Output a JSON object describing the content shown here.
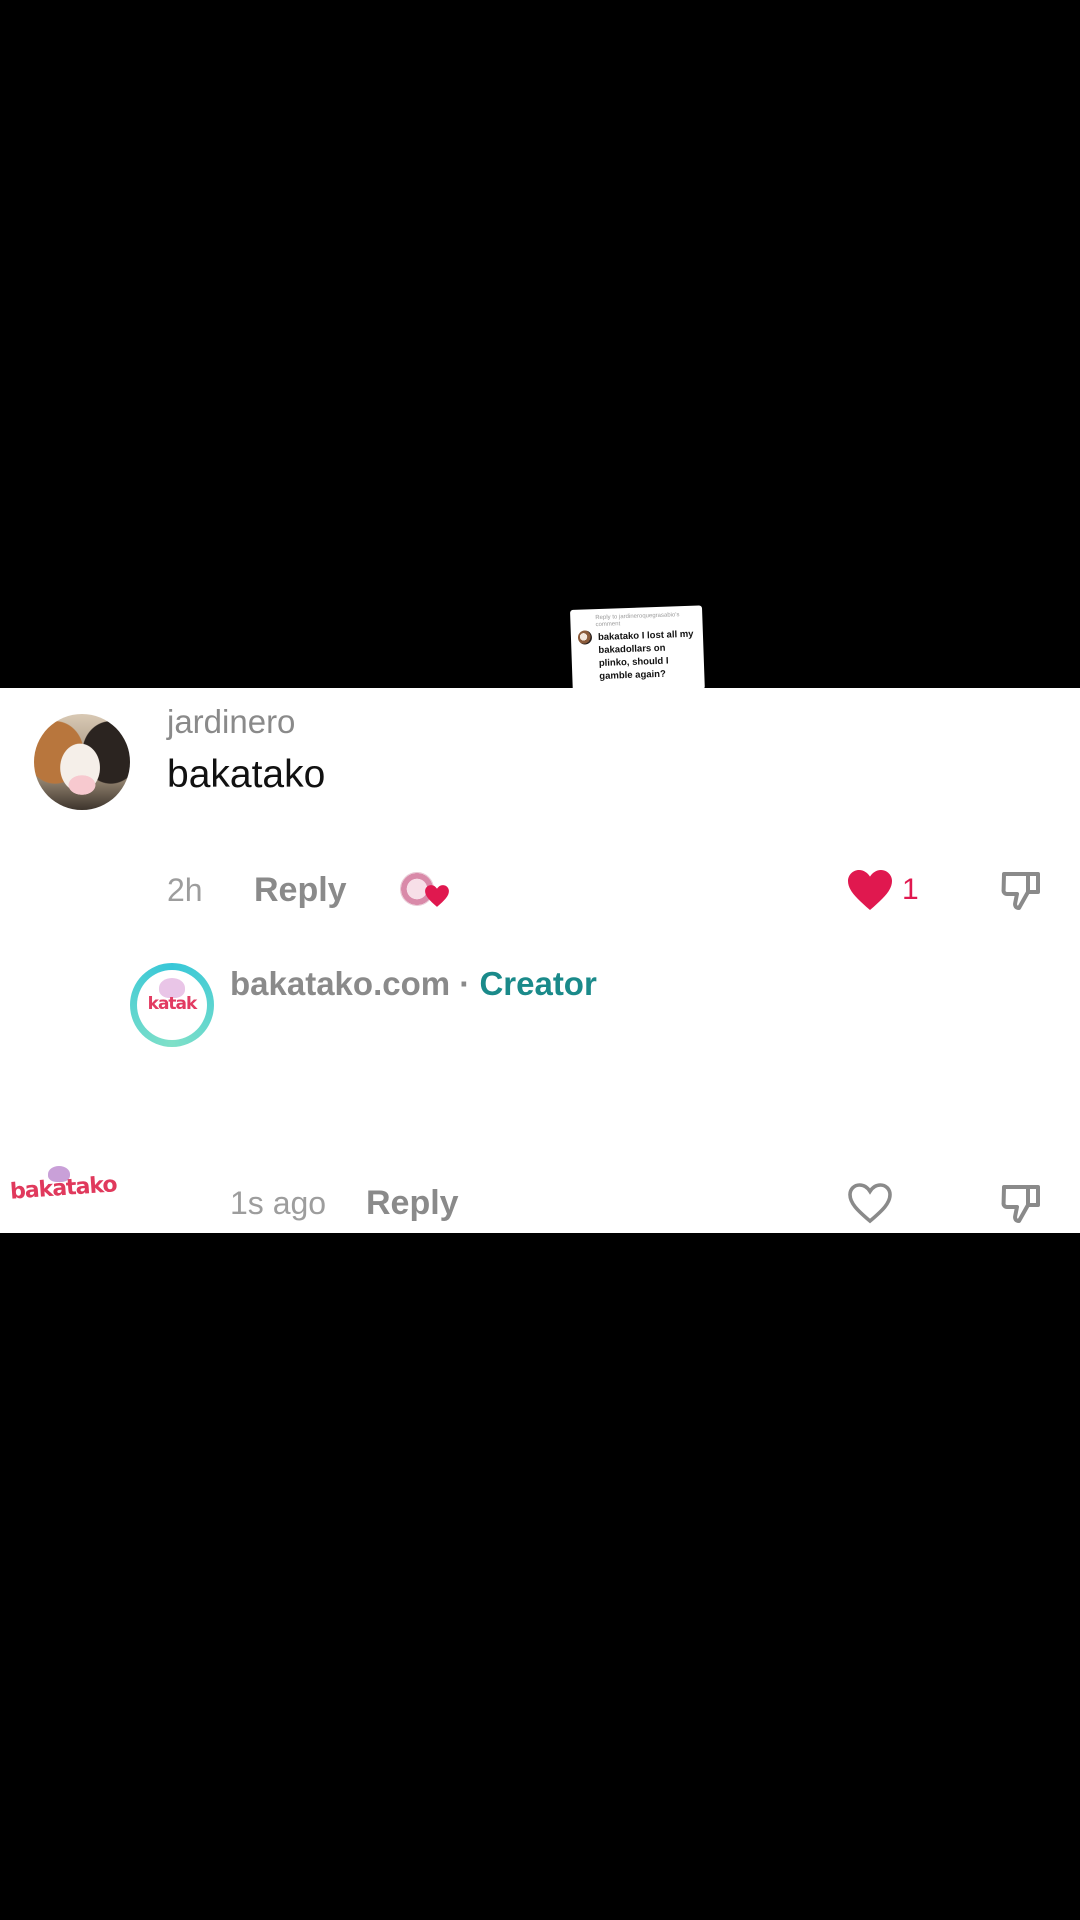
{
  "sticker": {
    "header": "Reply to jardineroquegrasabio's comment",
    "text": "bakatako I lost all my bakadollars on plinko, should I gamble again?"
  },
  "comment": {
    "username": "jardinero",
    "text": "bakatako",
    "time": "2h",
    "reply_label": "Reply",
    "like_count": "1",
    "liked": true,
    "liked_by_creator": true
  },
  "creator_reply": {
    "name": "bakatako.com",
    "separator": "·",
    "badge": "Creator",
    "time": "1s ago",
    "reply_label": "Reply",
    "liked": false
  },
  "watermark": {
    "text": "bakatako"
  },
  "icons": {
    "heart": "heart-icon",
    "heart_outline": "heart-outline-icon",
    "dislike": "thumbs-down-icon"
  },
  "colors": {
    "accent_red": "#e0184f",
    "creator_teal": "#1a8a8a",
    "muted_text": "#8a8a8a"
  }
}
